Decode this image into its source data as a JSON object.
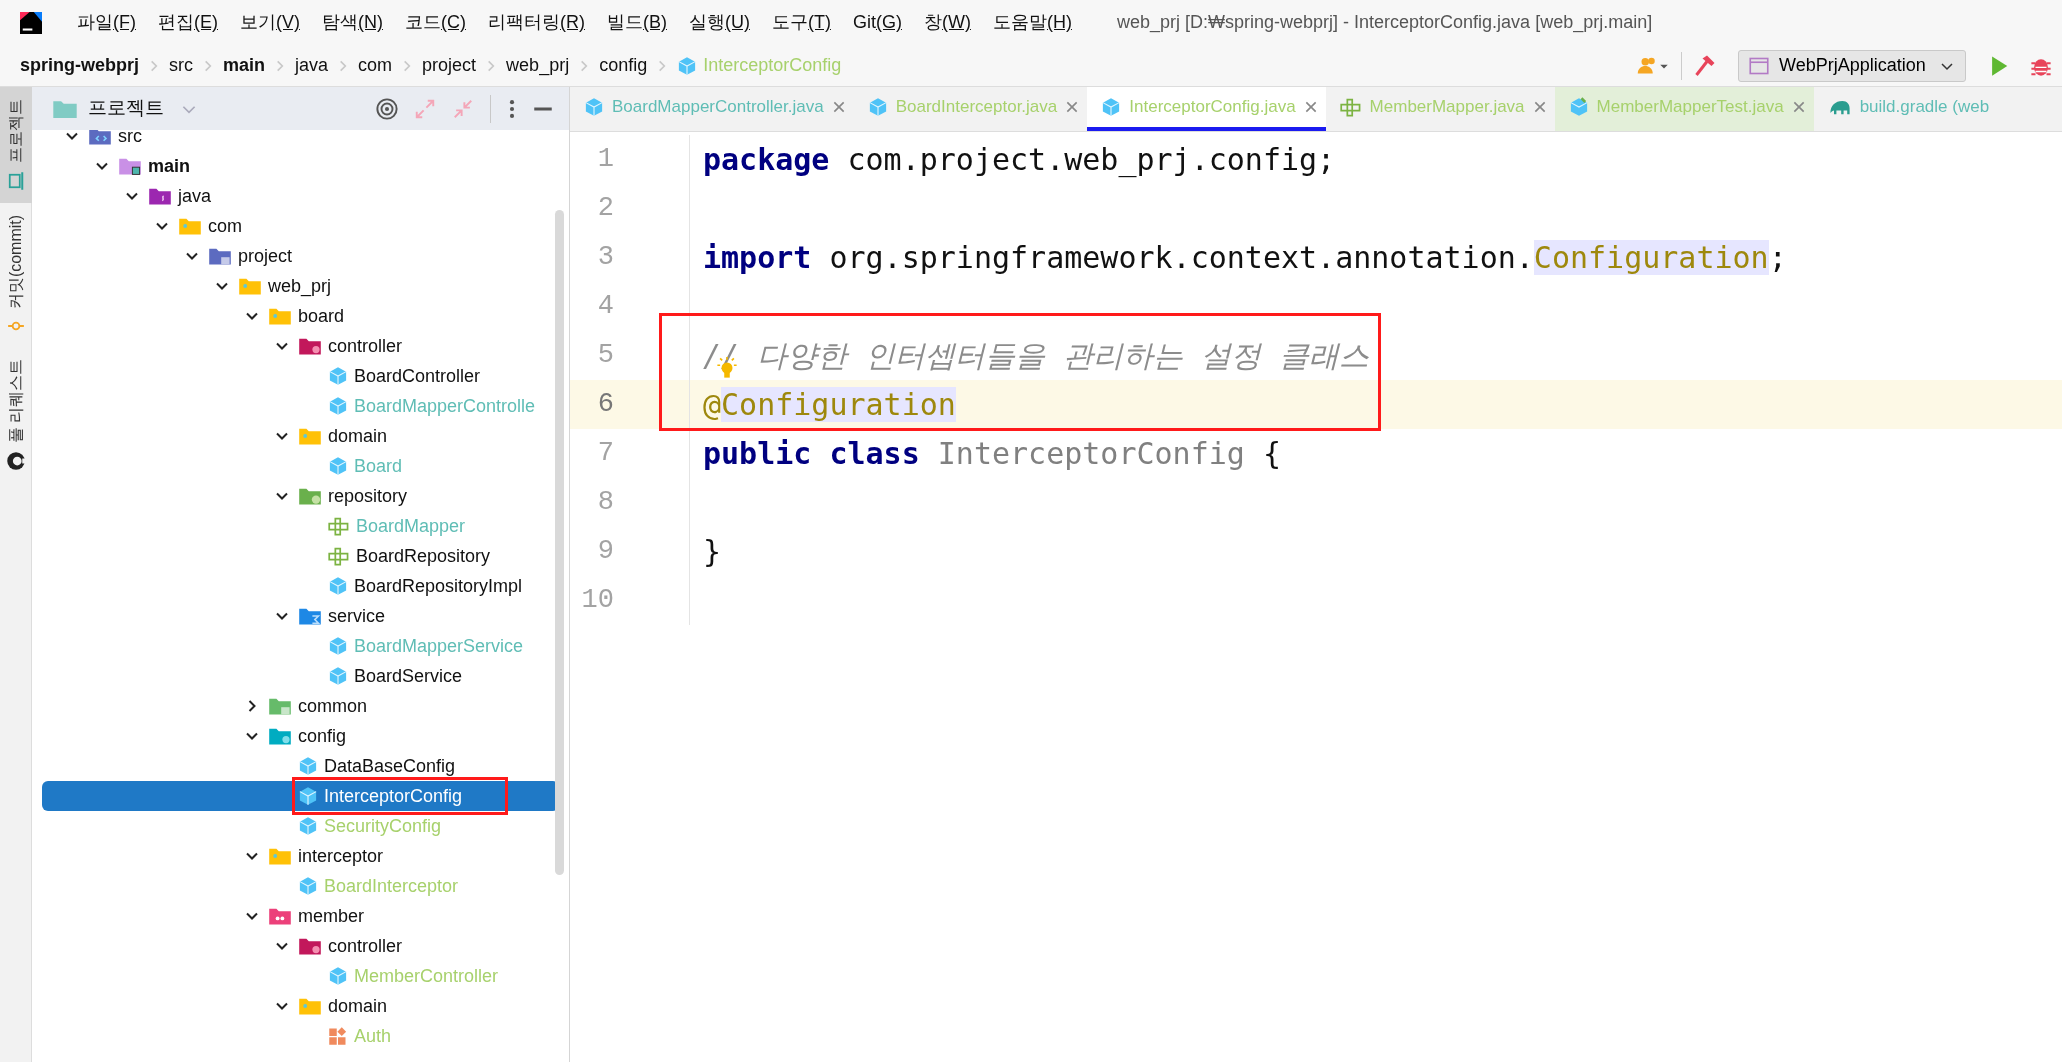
{
  "menu_bar": {
    "items": [
      {
        "label": "파일",
        "mnemonic": "(F)"
      },
      {
        "label": "편집",
        "mnemonic": "(E)"
      },
      {
        "label": "보기",
        "mnemonic": "(V)"
      },
      {
        "label": "탐색",
        "mnemonic": "(N)"
      },
      {
        "label": "코드",
        "mnemonic": "(C)"
      },
      {
        "label": "리팩터링",
        "mnemonic": "(R)"
      },
      {
        "label": "빌드",
        "mnemonic": "(B)"
      },
      {
        "label": "실행",
        "mnemonic": "(U)"
      },
      {
        "label": "도구",
        "mnemonic": "(T)"
      },
      {
        "label": "Git",
        "mnemonic": "(G)"
      },
      {
        "label": "창",
        "mnemonic": "(W)"
      },
      {
        "label": "도움말",
        "mnemonic": "(H)"
      }
    ],
    "title": "web_prj [D:₩spring-webprj] - InterceptorConfig.java [web_prj.main]"
  },
  "breadcrumb": [
    {
      "label": "spring-webprj",
      "kind": "folder",
      "bold": true
    },
    {
      "label": "src",
      "kind": "folder"
    },
    {
      "label": "main",
      "kind": "folder",
      "bold": true
    },
    {
      "label": "java",
      "kind": "folder"
    },
    {
      "label": "com",
      "kind": "folder"
    },
    {
      "label": "project",
      "kind": "folder"
    },
    {
      "label": "web_prj",
      "kind": "folder"
    },
    {
      "label": "config",
      "kind": "folder"
    },
    {
      "label": "InterceptorConfig",
      "kind": "class",
      "color": "#a7d16c"
    }
  ],
  "toolbar": {
    "run_config": "WebPrjApplication"
  },
  "side_strip": [
    {
      "label": "프로젝트",
      "kind": "project",
      "selected": true
    },
    {
      "label": "커밋(commit)",
      "kind": "commit",
      "selected": false
    },
    {
      "label": "풀 리퀘스트",
      "kind": "pull-request",
      "selected": false
    }
  ],
  "project_panel": {
    "title": "프로젝트",
    "tree": [
      {
        "label": "src",
        "kind": "source-folder",
        "expanded": true,
        "selected": false,
        "boxed": false,
        "children": [
          {
            "label": "main",
            "kind": "module-folder",
            "bold": true,
            "expanded": true,
            "selected": false,
            "boxed": false,
            "children": [
              {
                "label": "java",
                "kind": "java-folder",
                "expanded": true,
                "selected": false,
                "boxed": false,
                "children": [
                  {
                    "label": "com",
                    "kind": "package",
                    "expanded": true,
                    "selected": false,
                    "boxed": false,
                    "children": [
                      {
                        "label": "project",
                        "kind": "package-alt",
                        "expanded": true,
                        "selected": false,
                        "boxed": false,
                        "children": [
                          {
                            "label": "web_prj",
                            "kind": "package",
                            "expanded": true,
                            "selected": false,
                            "boxed": false,
                            "children": [
                              {
                                "label": "board",
                                "kind": "package",
                                "expanded": true,
                                "selected": false,
                                "boxed": false,
                                "children": [
                                  {
                                    "label": "controller",
                                    "kind": "controller-folder",
                                    "expanded": true,
                                    "selected": false,
                                    "boxed": false,
                                    "children": [
                                      {
                                        "label": "BoardController",
                                        "kind": "class",
                                        "color": "#111111",
                                        "selected": false,
                                        "boxed": false
                                      },
                                      {
                                        "label": "BoardMapperControlle",
                                        "kind": "class",
                                        "color": "#5fbdb5",
                                        "selected": false,
                                        "boxed": false
                                      }
                                    ]
                                  },
                                  {
                                    "label": "domain",
                                    "kind": "package",
                                    "expanded": true,
                                    "selected": false,
                                    "boxed": false,
                                    "children": [
                                      {
                                        "label": "Board",
                                        "kind": "class",
                                        "color": "#5fbdb5",
                                        "selected": false,
                                        "boxed": false
                                      }
                                    ]
                                  },
                                  {
                                    "label": "repository",
                                    "kind": "repository-folder",
                                    "expanded": true,
                                    "selected": false,
                                    "boxed": false,
                                    "children": [
                                      {
                                        "label": "BoardMapper",
                                        "kind": "mapper",
                                        "color": "#5fbdb5",
                                        "selected": false,
                                        "boxed": false
                                      },
                                      {
                                        "label": "BoardRepository",
                                        "kind": "mapper",
                                        "color": "#111111",
                                        "selected": false,
                                        "boxed": false
                                      },
                                      {
                                        "label": "BoardRepositoryImpl",
                                        "kind": "class",
                                        "color": "#111111",
                                        "selected": false,
                                        "boxed": false
                                      }
                                    ]
                                  },
                                  {
                                    "label": "service",
                                    "kind": "service-folder",
                                    "expanded": true,
                                    "selected": false,
                                    "boxed": false,
                                    "children": [
                                      {
                                        "label": "BoardMapperService",
                                        "kind": "class",
                                        "color": "#5fbdb5",
                                        "selected": false,
                                        "boxed": false
                                      },
                                      {
                                        "label": "BoardService",
                                        "kind": "class",
                                        "color": "#111111",
                                        "selected": false,
                                        "boxed": false
                                      }
                                    ]
                                  }
                                ]
                              },
                              {
                                "label": "common",
                                "kind": "common-folder",
                                "expanded": false,
                                "selected": false,
                                "boxed": false
                              },
                              {
                                "label": "config",
                                "kind": "config-folder",
                                "expanded": true,
                                "selected": false,
                                "boxed": false,
                                "children": [
                                  {
                                    "label": "DataBaseConfig",
                                    "kind": "class",
                                    "color": "#111111",
                                    "selected": false,
                                    "boxed": false
                                  },
                                  {
                                    "label": "InterceptorConfig",
                                    "kind": "class",
                                    "selected": true,
                                    "boxed": true
                                  },
                                  {
                                    "label": "SecurityConfig",
                                    "kind": "class",
                                    "color": "#a7d16c",
                                    "selected": false,
                                    "boxed": false
                                  }
                                ]
                              },
                              {
                                "label": "interceptor",
                                "kind": "package",
                                "expanded": true,
                                "selected": false,
                                "boxed": false,
                                "children": [
                                  {
                                    "label": "BoardInterceptor",
                                    "kind": "class",
                                    "color": "#a7d16c",
                                    "selected": false,
                                    "boxed": false
                                  }
                                ]
                              },
                              {
                                "label": "member",
                                "kind": "member-folder",
                                "expanded": true,
                                "selected": false,
                                "boxed": false,
                                "children": [
                                  {
                                    "label": "controller",
                                    "kind": "controller-folder",
                                    "expanded": true,
                                    "selected": false,
                                    "boxed": false,
                                    "children": [
                                      {
                                        "label": "MemberController",
                                        "kind": "class",
                                        "color": "#a7d16c",
                                        "selected": false,
                                        "boxed": false
                                      }
                                    ]
                                  },
                                  {
                                    "label": "domain",
                                    "kind": "package",
                                    "expanded": true,
                                    "selected": false,
                                    "boxed": false,
                                    "children": [
                                      {
                                        "label": "Auth",
                                        "kind": "enum",
                                        "color": "#a7d16c",
                                        "selected": false,
                                        "boxed": false
                                      }
                                    ]
                                  }
                                ]
                              }
                            ]
                          }
                        ]
                      }
                    ]
                  }
                ]
              }
            ]
          }
        ]
      }
    ]
  },
  "tabs": [
    {
      "label": "BoardMapperController.java",
      "kind": "class",
      "color": "#5fbdb5",
      "selected": false,
      "closable": true
    },
    {
      "label": "BoardInterceptor.java",
      "kind": "class",
      "color": "#a7d16c",
      "selected": false,
      "closable": true
    },
    {
      "label": "InterceptorConfig.java",
      "kind": "class",
      "color": "#a7d16c",
      "selected": true,
      "closable": true
    },
    {
      "label": "MemberMapper.java",
      "kind": "mapper",
      "color": "#a7d16c",
      "selected": false,
      "closable": true
    },
    {
      "label": "MemberMapperTest.java",
      "kind": "test",
      "color": "#a7d16c",
      "selected": false,
      "closable": true
    },
    {
      "label": "build.gradle (web",
      "kind": "gradle",
      "color": "#5fbdb5",
      "selected": false,
      "closable": false
    }
  ],
  "editor": {
    "lines": [
      {
        "number": "1",
        "current": false,
        "boxed": false,
        "bulb": false,
        "tokens": [
          {
            "text": "package",
            "kind": "keyword"
          },
          {
            "text": " com.project.web_prj.config;",
            "kind": "plain"
          }
        ]
      },
      {
        "number": "2",
        "current": false,
        "boxed": false,
        "bulb": false
      },
      {
        "number": "3",
        "current": false,
        "boxed": false,
        "bulb": false,
        "tokens": [
          {
            "text": "import",
            "kind": "keyword"
          },
          {
            "text": " org.springframework.context.annotation.",
            "kind": "plain"
          },
          {
            "text": "Configuration",
            "kind": "annotation",
            "highlighted": true
          },
          {
            "text": ";",
            "kind": "plain"
          }
        ]
      },
      {
        "number": "4",
        "current": false,
        "boxed": false,
        "bulb": false
      },
      {
        "number": "5",
        "current": false,
        "boxed": true,
        "bulb": true,
        "tokens": [
          {
            "text": "// 다양한 인터셉터들을 관리하는 설정 클래스",
            "kind": "comment"
          }
        ]
      },
      {
        "number": "6",
        "current": true,
        "boxed": true,
        "bulb": false,
        "tokens": [
          {
            "text": "@",
            "kind": "annotation"
          },
          {
            "text": "Configuration",
            "kind": "annotation",
            "highlighted": true
          }
        ]
      },
      {
        "number": "7",
        "current": false,
        "boxed": false,
        "bulb": false,
        "tokens": [
          {
            "text": "public class",
            "kind": "keyword"
          },
          {
            "text": " InterceptorConfig",
            "kind": "unused"
          },
          {
            "text": " {",
            "kind": "plain"
          }
        ]
      },
      {
        "number": "8",
        "current": false,
        "boxed": false,
        "bulb": false
      },
      {
        "number": "9",
        "current": false,
        "boxed": false,
        "bulb": false,
        "tokens": [
          {
            "text": "}",
            "kind": "plain"
          }
        ]
      },
      {
        "number": "10",
        "current": false,
        "boxed": false,
        "bulb": false
      }
    ]
  }
}
